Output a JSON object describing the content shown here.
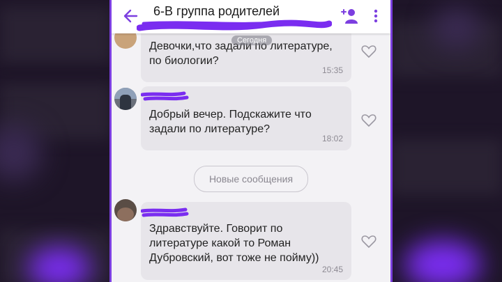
{
  "header": {
    "title": "6-В группа родителей"
  },
  "date_separator": "Сегодня",
  "messages": [
    {
      "text_lines": [
        "Девочки,что задали по литературе,",
        "по биологии?"
      ],
      "time": "15:35"
    },
    {
      "text_lines": [
        "Добрый вечер. Подскажите что",
        "задали по литературе?"
      ],
      "time": "18:02"
    },
    {
      "text_lines": [
        "Здравствуйте. Говорит по",
        "литературе какой то Роман",
        "Дубровский, вот тоже не пойму))"
      ],
      "time": "20:45"
    }
  ],
  "new_messages_label": "Новые сообщения",
  "colors": {
    "accent": "#7c3fe0",
    "bubble": "#e7e5ea",
    "scribble": "#7a2df0"
  },
  "icons": [
    "back-arrow-icon",
    "add-member-icon",
    "menu-dots-icon",
    "heart-icon"
  ]
}
